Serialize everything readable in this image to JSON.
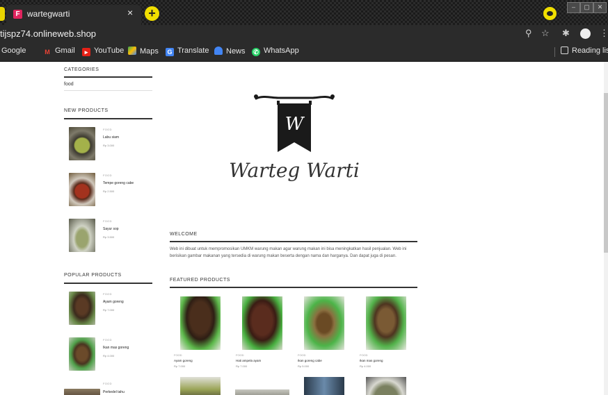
{
  "browser": {
    "tab_title": "wartegwarti",
    "favicon_letter": "F",
    "tab_close": "×",
    "new_tab": "+",
    "url": "tijspz74.onlineweb.shop",
    "bookmarks": [
      "Google",
      "Gmail",
      "YouTube",
      "Maps",
      "Translate",
      "News",
      "WhatsApp"
    ],
    "reading_list": "Reading list",
    "window_buttons": [
      "–",
      "▢",
      "✕"
    ]
  },
  "sidebar": {
    "categories_title": "CATEGORIES",
    "category_item": "food",
    "new_products_title": "NEW PRODUCTS",
    "new_products": [
      {
        "tag": "FOOD",
        "name": "Labu siam",
        "price": "Rp 3.000"
      },
      {
        "tag": "FOOD",
        "name": "Tempe goreng cabe",
        "price": "Rp 2.500"
      },
      {
        "tag": "FOOD",
        "name": "Sayur sop",
        "price": "Rp 3.500"
      }
    ],
    "popular_products_title": "POPULAR PRODUCTS",
    "popular_products": [
      {
        "tag": "FOOD",
        "name": "Ayam goreng",
        "price": "Rp 7.000"
      },
      {
        "tag": "FOOD",
        "name": "Ikan mas goreng",
        "price": "Rp 4.000"
      },
      {
        "tag": "FOOD",
        "name": "Perkedel tahu",
        "price": ""
      }
    ]
  },
  "main": {
    "logo_text": "Warteg Warti",
    "logo_monogram": "W",
    "welcome_title": "WELCOME",
    "welcome_text": "Web ini dibuat untuk mempromosikan UMKM warung makan agar warung makan ini bisa meningkatkan hasil penjualan. Web ini berisikan gambar makanan yang tersedia di warung makan beserta dengan nama dan harganya. Dan dapat juga di pesan.",
    "featured_title": "FEATURED PRODUCTS",
    "featured_products": [
      {
        "tag": "FOOD",
        "name": "Ayam goreng",
        "price": "Rp 7.000"
      },
      {
        "tag": "FOOD",
        "name": "Hati ampela ayam",
        "price": "Rp 7.000"
      },
      {
        "tag": "FOOD",
        "name": "Ikan goreng cabe",
        "price": "Rp 5.000"
      },
      {
        "tag": "FOOD",
        "name": "Ikan mas goreng",
        "price": "Rp 4.000"
      }
    ]
  },
  "colors": {
    "accent_yellow": "#f1df00",
    "plate_green": "#3aa64a",
    "banner_black": "#1a1a1a"
  }
}
